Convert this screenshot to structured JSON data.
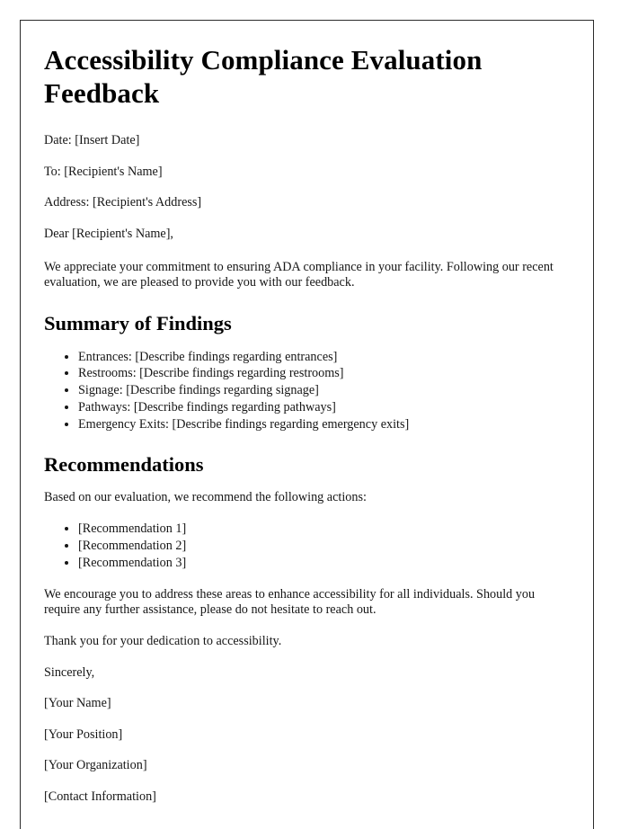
{
  "document": {
    "title": "Accessibility Compliance Evaluation Feedback",
    "meta": {
      "date_line": "Date: [Insert Date]",
      "to_line": "To: [Recipient's Name]",
      "address_line": "Address: [Recipient's Address]"
    },
    "salutation": "Dear [Recipient's Name],",
    "intro_paragraph": "We appreciate your commitment to ensuring ADA compliance in your facility. Following our recent evaluation, we are pleased to provide you with our feedback.",
    "sections": {
      "findings": {
        "heading": "Summary of Findings",
        "items": [
          "Entrances: [Describe findings regarding entrances]",
          "Restrooms: [Describe findings regarding restrooms]",
          "Signage: [Describe findings regarding signage]",
          "Pathways: [Describe findings regarding pathways]",
          "Emergency Exits: [Describe findings regarding emergency exits]"
        ]
      },
      "recommendations": {
        "heading": "Recommendations",
        "lead_in": "Based on our evaluation, we recommend the following actions:",
        "items": [
          "[Recommendation 1]",
          "[Recommendation 2]",
          "[Recommendation 3]"
        ]
      }
    },
    "closing": {
      "encouragement": "We encourage you to address these areas to enhance accessibility for all individuals. Should you require any further assistance, please do not hesitate to reach out.",
      "thanks": "Thank you for your dedication to accessibility.",
      "sign_off": "Sincerely,"
    },
    "signature_block": [
      "[Your Name]",
      "[Your Position]",
      "[Your Organization]",
      "[Contact Information]"
    ]
  },
  "colors": {
    "page_background": "#ffffff",
    "page_border": "#2b2b2b",
    "heading_text": "#000000",
    "body_text": "#161616"
  }
}
